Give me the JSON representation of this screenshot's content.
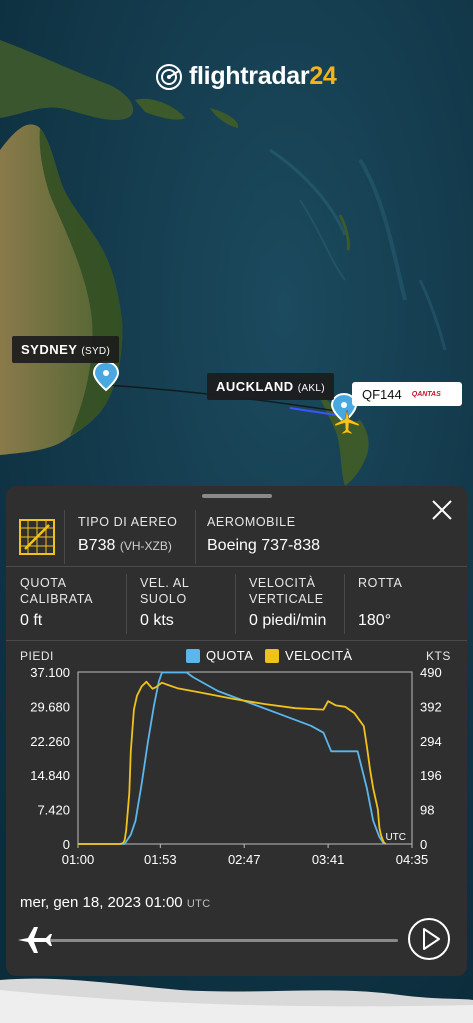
{
  "app": {
    "logo_prefix": "flightradar",
    "logo_suffix": "24"
  },
  "map": {
    "origin": {
      "name": "SYDNEY",
      "code": "(SYD)"
    },
    "destination": {
      "name": "AUCKLAND",
      "code": "(AKL)"
    },
    "flight": {
      "number": "QF144",
      "airline_logo": "QANTAS"
    }
  },
  "panel": {
    "aircraft_type_label": "TIPO DI AEREO",
    "aircraft_type_value": "B738",
    "aircraft_registration": "(VH-XZB)",
    "aircraft_label": "AEROMOBILE",
    "aircraft_value": "Boeing 737-838",
    "stats": [
      {
        "label_lines": [
          "QUOTA",
          "CALIBRATA"
        ],
        "value": "0 ft"
      },
      {
        "label_lines": [
          "VEL. AL",
          "SUOLO"
        ],
        "value": "0 kts"
      },
      {
        "label_lines": [
          "VELOCITÀ",
          "VERTICALE"
        ],
        "value": "0 piedi/min"
      },
      {
        "label_lines": [
          "ROTTA"
        ],
        "value": "180°"
      }
    ]
  },
  "chart_data": {
    "type": "line",
    "left_axis_title": "PIEDI",
    "right_axis_title": "KTS",
    "timezone_label": "UTC",
    "x_ticks": [
      "01:00",
      "01:53",
      "02:47",
      "03:41",
      "04:35"
    ],
    "x_ticks_min": [
      0,
      53,
      107,
      161,
      215
    ],
    "y_left_ticks": [
      "37.100",
      "29.680",
      "22.260",
      "14.840",
      "7.420",
      "0"
    ],
    "y_left_range": [
      0,
      37100
    ],
    "y_right_ticks": [
      "490",
      "392",
      "294",
      "196",
      "98",
      "0"
    ],
    "y_right_range": [
      0,
      490
    ],
    "x_range_min": [
      0,
      215
    ],
    "series": [
      {
        "name": "QUOTA",
        "color": "#5bb6ec",
        "axis": "left",
        "points": [
          [
            0,
            0
          ],
          [
            30,
            0
          ],
          [
            34,
            2000
          ],
          [
            37,
            5000
          ],
          [
            41,
            13000
          ],
          [
            45,
            22000
          ],
          [
            49,
            30000
          ],
          [
            52,
            35000
          ],
          [
            54,
            37000
          ],
          [
            70,
            37000
          ],
          [
            74,
            36000
          ],
          [
            90,
            33000
          ],
          [
            110,
            30500
          ],
          [
            130,
            28000
          ],
          [
            150,
            25500
          ],
          [
            158,
            24000
          ],
          [
            163,
            20000
          ],
          [
            168,
            20000
          ],
          [
            180,
            20000
          ],
          [
            186,
            12000
          ],
          [
            190,
            5000
          ],
          [
            194,
            1500
          ],
          [
            197,
            0
          ]
        ]
      },
      {
        "name": "VELOCITÀ",
        "color": "#f1c21a",
        "axis": "left",
        "points": [
          [
            0,
            0
          ],
          [
            27,
            0
          ],
          [
            29,
            200
          ],
          [
            30,
            800
          ],
          [
            31,
            3000
          ],
          [
            33,
            11000
          ],
          [
            34,
            20000
          ],
          [
            36,
            29000
          ],
          [
            38,
            32000
          ],
          [
            41,
            34000
          ],
          [
            44,
            35000
          ],
          [
            46,
            34200
          ],
          [
            48,
            33500
          ],
          [
            50,
            33800
          ],
          [
            54,
            34800
          ],
          [
            58,
            34300
          ],
          [
            64,
            33600
          ],
          [
            80,
            32600
          ],
          [
            100,
            31300
          ],
          [
            120,
            30200
          ],
          [
            140,
            29300
          ],
          [
            158,
            29000
          ],
          [
            161,
            30800
          ],
          [
            166,
            29900
          ],
          [
            172,
            29600
          ],
          [
            178,
            28200
          ],
          [
            181,
            26800
          ],
          [
            184,
            25400
          ],
          [
            186,
            21000
          ],
          [
            188,
            16000
          ],
          [
            190,
            12000
          ],
          [
            192,
            9000
          ],
          [
            193,
            7500
          ],
          [
            194,
            3500
          ],
          [
            195,
            2000
          ],
          [
            196,
            1000
          ],
          [
            197,
            300
          ],
          [
            198,
            0
          ]
        ]
      }
    ]
  },
  "footer": {
    "date": "mer, gen 18, 2023",
    "time": "01:00",
    "tz": "UTC"
  }
}
